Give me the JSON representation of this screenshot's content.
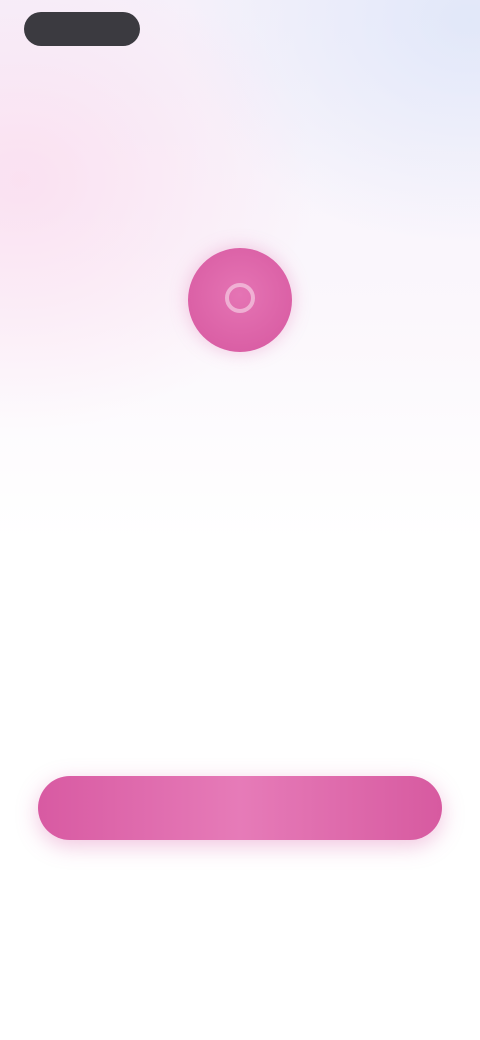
{
  "status_pill": {
    "label": ""
  },
  "logo": {
    "icon": "app-logo-icon",
    "color": "#dc64a8"
  },
  "headline": {
    "line1": "",
    "line2": ""
  },
  "primary_button": {
    "label": ""
  },
  "secondary_link": {
    "label": ""
  },
  "tertiary_link": {
    "label": ""
  },
  "colors": {
    "accent": "#d85aa2",
    "text_dark": "#333338",
    "pill": "#3b3a40"
  }
}
